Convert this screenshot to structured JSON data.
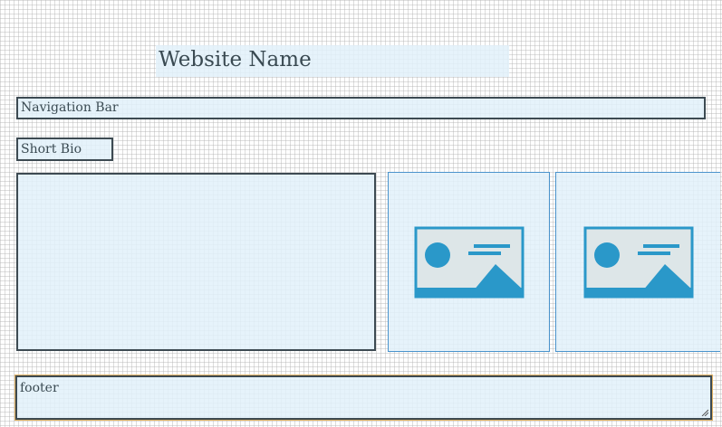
{
  "header": {
    "site_name": "Website Name"
  },
  "nav": {
    "label": "Navigation Bar"
  },
  "bio": {
    "label": "Short Bio"
  },
  "images": [
    {
      "icon": "image-placeholder-icon"
    },
    {
      "icon": "image-placeholder-icon"
    }
  ],
  "footer": {
    "label": "footer"
  },
  "colors": {
    "panel_fill": "#e2f1fa",
    "border": "#3d4a52",
    "image_accent": "#2a98c9",
    "image_bg": "#dde6e8",
    "footer_glow": "#e0b060"
  }
}
